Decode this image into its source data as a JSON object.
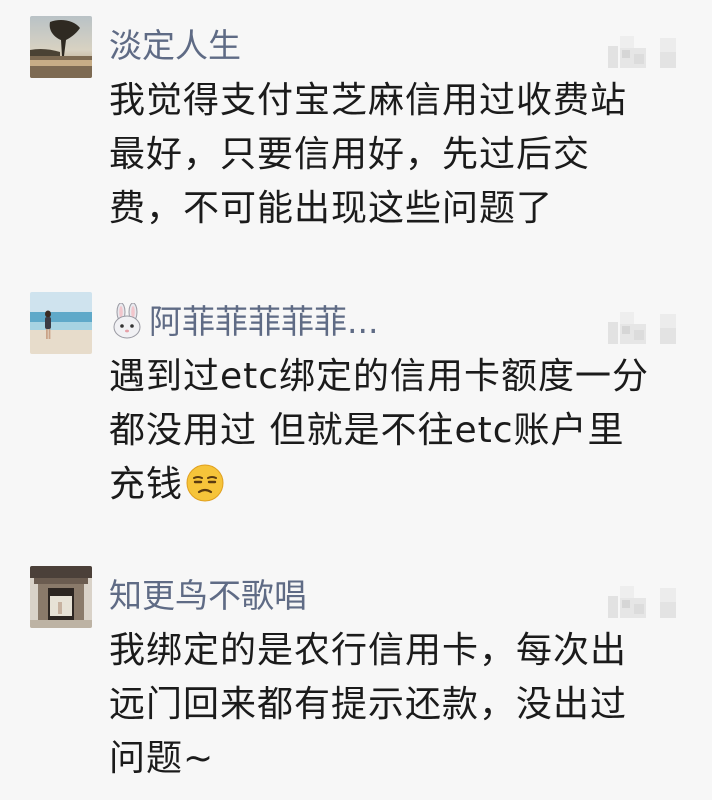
{
  "comments": [
    {
      "name": "淡定人生",
      "avatar": "lake-sunset-avatar",
      "lines": [
        "我觉得支付宝芝麻信用过收费站",
        "最好，只要信用好，先过后交",
        "费，不可能出现这些问题了"
      ]
    },
    {
      "name": "阿菲菲菲菲菲...",
      "name_prefix_icon": "rabbit-emoji-icon",
      "avatar": "beach-girl-avatar",
      "lines": [
        "遇到过etc绑定的信用卡额度一分",
        "都没用过 但就是不往etc账户里",
        "充钱"
      ],
      "trailing_emoji": "unamused-face-emoji"
    },
    {
      "name": "知更鸟不歌唱",
      "avatar": "doorway-avatar",
      "lines": [
        "我绑定的是农行信用卡，每次出",
        "远门回来都有提示还款，没出过",
        "问题~"
      ]
    }
  ],
  "like_icon": "thumbs-up-icon",
  "colors": {
    "background": "#f7f7f7",
    "name": "#5f6b85",
    "text": "#1b1b1b"
  }
}
